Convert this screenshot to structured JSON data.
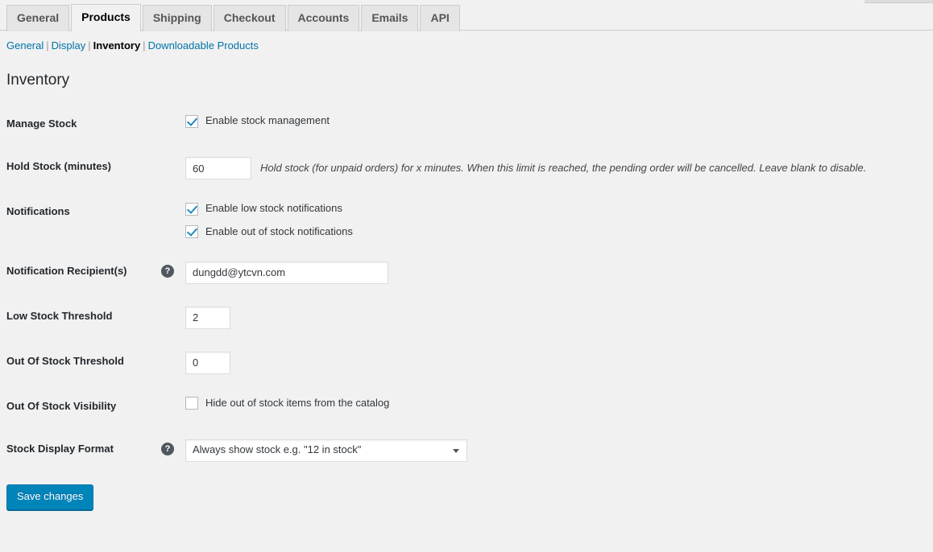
{
  "tabs": [
    {
      "label": "General",
      "active": false
    },
    {
      "label": "Products",
      "active": true
    },
    {
      "label": "Shipping",
      "active": false
    },
    {
      "label": "Checkout",
      "active": false
    },
    {
      "label": "Accounts",
      "active": false
    },
    {
      "label": "Emails",
      "active": false
    },
    {
      "label": "API",
      "active": false
    }
  ],
  "subnav": {
    "items": [
      {
        "label": "General",
        "current": false
      },
      {
        "label": "Display",
        "current": false
      },
      {
        "label": "Inventory",
        "current": true
      },
      {
        "label": "Downloadable Products",
        "current": false
      }
    ],
    "separator": "|"
  },
  "section": {
    "title": "Inventory"
  },
  "rows": {
    "manage_stock": {
      "label": "Manage Stock",
      "checkbox_label": "Enable stock management",
      "checked": true
    },
    "hold_stock": {
      "label": "Hold Stock (minutes)",
      "value": "60",
      "description": "Hold stock (for unpaid orders) for x minutes. When this limit is reached, the pending order will be cancelled. Leave blank to disable."
    },
    "notifications": {
      "label": "Notifications",
      "low_stock_label": "Enable low stock notifications",
      "low_stock_checked": true,
      "out_of_stock_label": "Enable out of stock notifications",
      "out_of_stock_checked": true
    },
    "notification_recipients": {
      "label": "Notification Recipient(s)",
      "help": "?",
      "value": "dungdd@ytcvn.com"
    },
    "low_stock_threshold": {
      "label": "Low Stock Threshold",
      "value": "2"
    },
    "out_of_stock_threshold": {
      "label": "Out Of Stock Threshold",
      "value": "0"
    },
    "out_of_stock_visibility": {
      "label": "Out Of Stock Visibility",
      "checkbox_label": "Hide out of stock items from the catalog",
      "checked": false
    },
    "stock_display_format": {
      "label": "Stock Display Format",
      "help": "?",
      "value": "Always show stock e.g. \"12 in stock\""
    }
  },
  "submit": {
    "label": "Save changes"
  },
  "colors": {
    "link": "#0073aa",
    "accent": "#0085ba",
    "check": "#1e8cbe",
    "background": "#f1f1f1",
    "tab_inactive": "#e5e5e5"
  }
}
